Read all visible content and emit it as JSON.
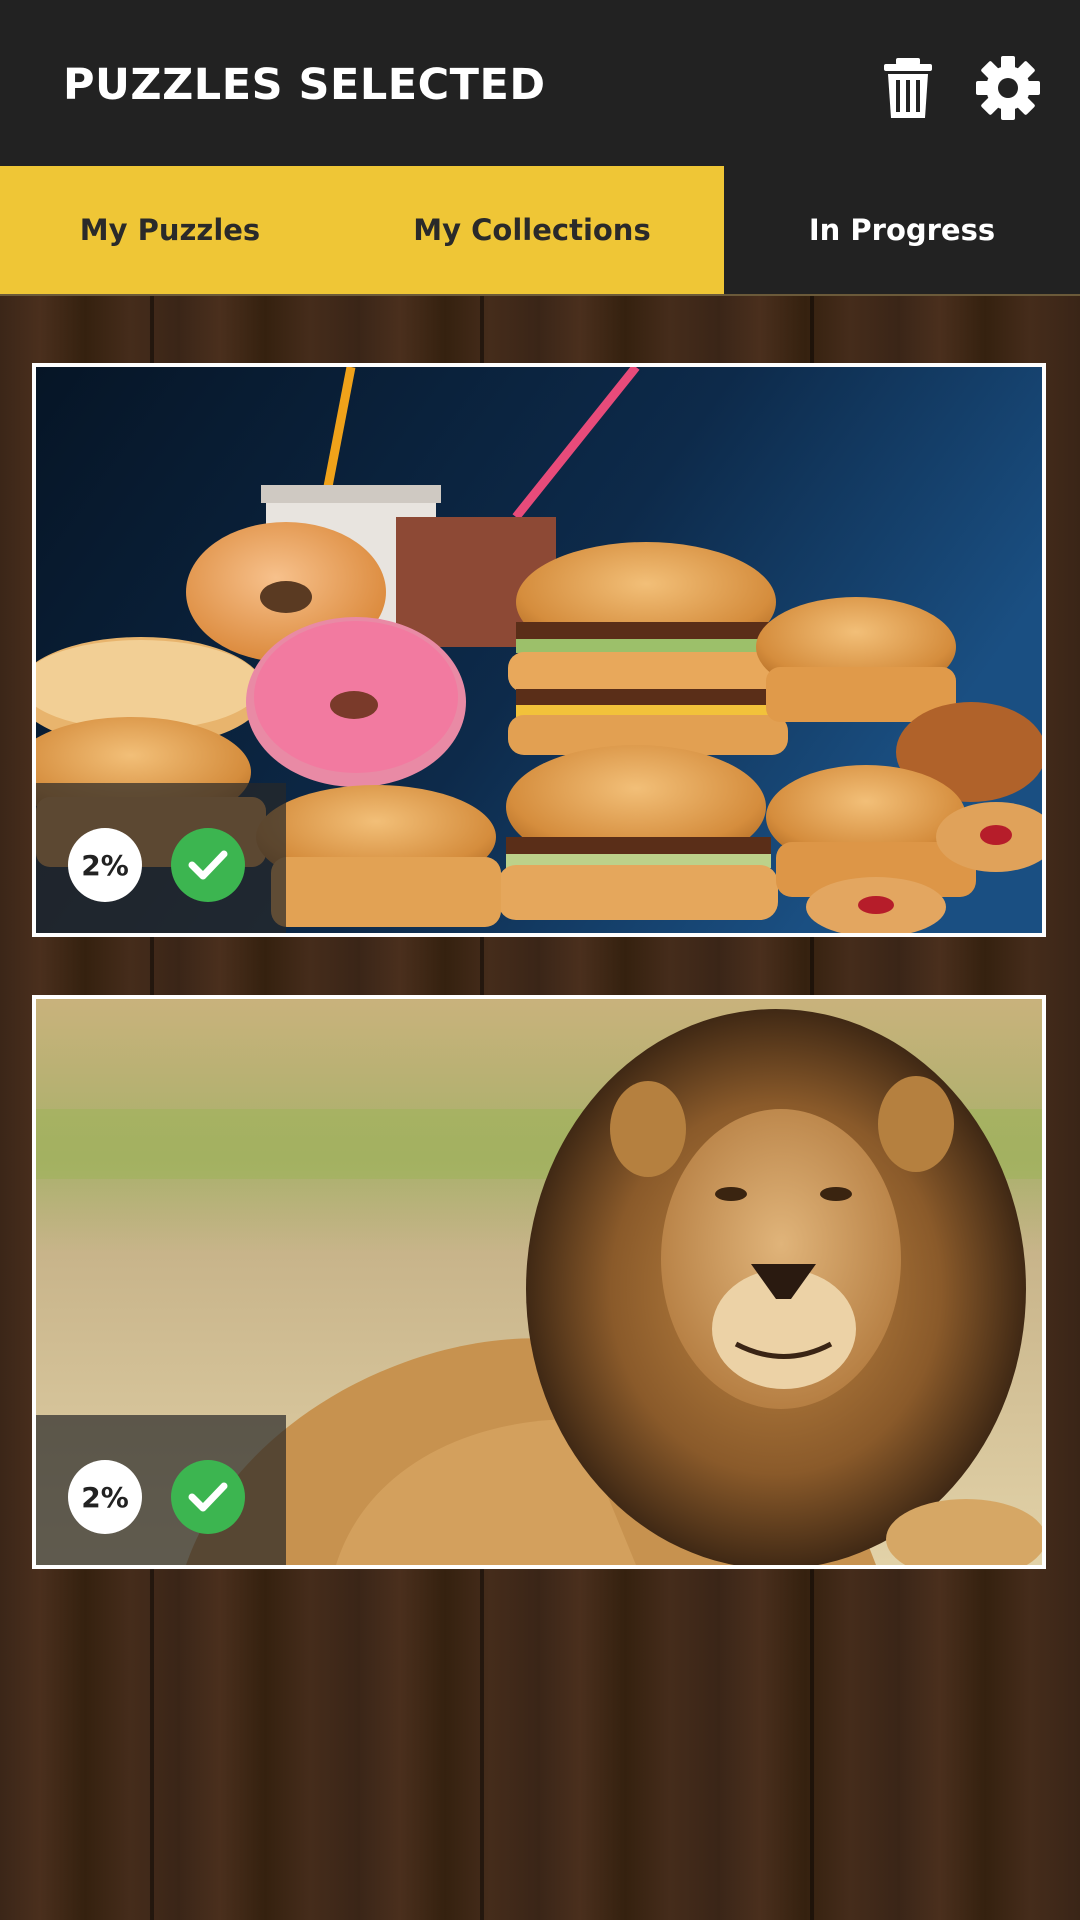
{
  "header": {
    "title": "PUZZLES SELECTED",
    "trash_icon": "trash-icon",
    "settings_icon": "gear-icon"
  },
  "tabs": [
    {
      "label": "My Puzzles",
      "active": true
    },
    {
      "label": "My Collections",
      "active": true
    },
    {
      "label": "In Progress",
      "active": false
    }
  ],
  "puzzles": [
    {
      "subject": "fast food",
      "progress": "2%",
      "selected": true
    },
    {
      "subject": "lion",
      "progress": "2%",
      "selected": true
    }
  ],
  "colors": {
    "header_bg": "#222222",
    "tab_active": "#efc636",
    "check_green": "#3cb550"
  }
}
